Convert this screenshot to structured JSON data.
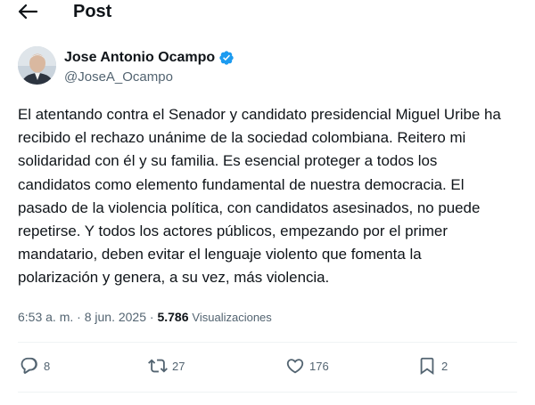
{
  "header": {
    "title": "Post"
  },
  "author": {
    "name": "Jose Antonio Ocampo",
    "handle": "@JoseA_Ocampo",
    "verified": true,
    "verified_color": "#1d9bf0"
  },
  "tweet": {
    "lines": [
      "El atentando contra el Senador y candidato presidencial Miguel Uribe ha",
      "recibido el rechazo unánime de la sociedad colombiana. Reitero mi",
      "solidaridad con él y su familia. Es esencial proteger a todos los",
      "candidatos  como elemento fundamental de nuestra democracia. El",
      "pasado de la violencia política, con candidatos asesinados, no puede",
      "repetirse. Y todos los actores públicos, empezando por el primer",
      "mandatario, deben evitar el lenguaje violento que fomenta la",
      "polarización y genera, a su vez, más violencia."
    ]
  },
  "meta": {
    "time": "6:53 a. m.",
    "separator": " · ",
    "date": "8 jun. 2025",
    "views_count": "5.786",
    "views_label": "Visualizaciones"
  },
  "actions": {
    "replies": "8",
    "reposts": "27",
    "likes": "176",
    "bookmarks": "2"
  },
  "colors": {
    "text": "#0f1419",
    "secondary": "#536471",
    "divider": "#eff3f4",
    "accent": "#1d9bf0"
  }
}
